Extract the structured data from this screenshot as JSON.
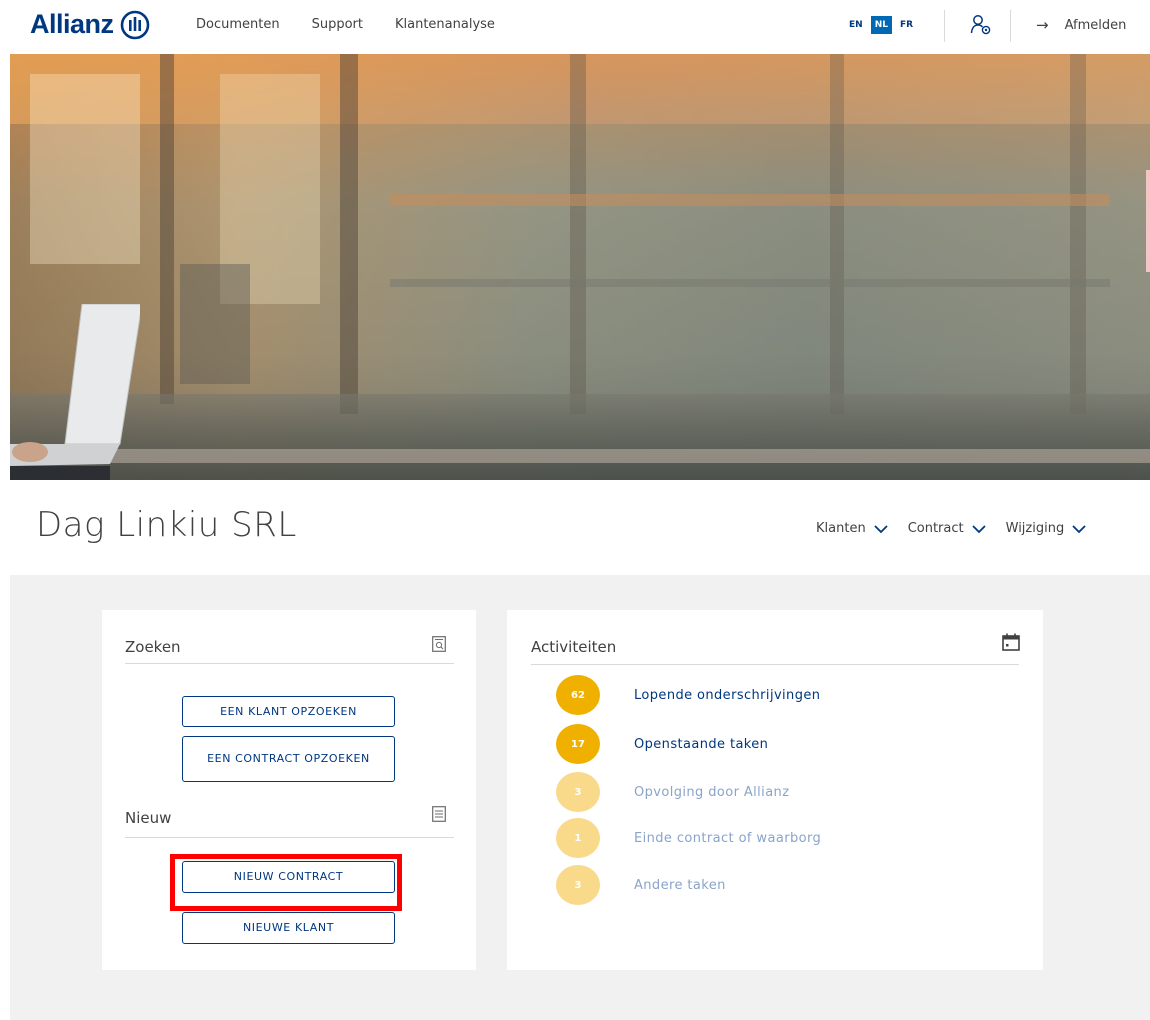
{
  "header": {
    "logo_text": "Allianz",
    "nav": [
      "Documenten",
      "Support",
      "Klantenanalyse"
    ],
    "languages": [
      "EN",
      "NL",
      "FR"
    ],
    "active_language": "NL",
    "logout_label": "Afmelden"
  },
  "page": {
    "title": "Dag Linkiu SRL",
    "menus": [
      "Klanten",
      "Contract",
      "Wijziging"
    ]
  },
  "zoeken": {
    "title": "Zoeken",
    "buttons": [
      "EEN KLANT OPZOEKEN",
      "EEN CONTRACT OPZOEKEN"
    ]
  },
  "nieuw": {
    "title": "Nieuw",
    "buttons": [
      "NIEUW CONTRACT",
      "NIEUWE KLANT"
    ]
  },
  "activiteiten": {
    "title": "Activiteiten",
    "items": [
      {
        "count": "62",
        "label": "Lopende onderschrijvingen",
        "emphasis": "strong"
      },
      {
        "count": "17",
        "label": "Openstaande taken",
        "emphasis": "strong"
      },
      {
        "count": "3",
        "label": "Opvolging door Allianz",
        "emphasis": "light"
      },
      {
        "count": "1",
        "label": "Einde contract of waarborg",
        "emphasis": "light"
      },
      {
        "count": "3",
        "label": "Andere taken",
        "emphasis": "light"
      }
    ]
  },
  "colors": {
    "brand": "#003781",
    "accent": "#0069b4",
    "bubble_strong": "#f0b000",
    "bubble_light": "#f9d98a",
    "highlight": "#ff0000"
  }
}
